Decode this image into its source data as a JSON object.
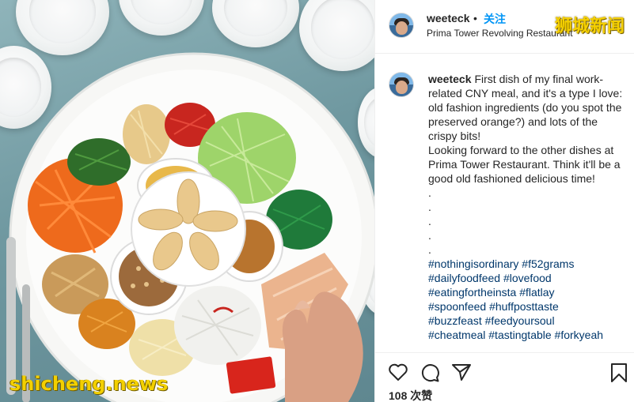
{
  "post": {
    "username": "weeteck",
    "follow_separator": "•",
    "follow_label": "关注",
    "location": "Prima Tower Revolving Restaurant"
  },
  "caption": {
    "username": "weeteck",
    "lines": [
      "First dish of my final work-related CNY meal, and it's a type I love: old fashion ingredients (do you spot the preserved orange?) and lots of the crispy bits!",
      "Looking forward to the other dishes at Prima Tower Restaurant. Think it'll be a good old fashioned delicious time!",
      ".",
      ".",
      ".",
      ".",
      "."
    ],
    "hashtags": [
      "#nothingisordinary #f52grams",
      "#dailyfoodfeed #lovefood",
      "#eatingfortheinsta #flatlay",
      "#spoonfeed #huffposttaste",
      "#buzzfeast #feedyoursoul",
      "#cheatmeal #tastingtable #forkyeah"
    ]
  },
  "actions": {
    "like_icon": "heart-icon",
    "comment_icon": "comment-icon",
    "share_icon": "paper-plane-icon",
    "save_icon": "bookmark-icon",
    "likes_text": "108 次赞"
  },
  "photo": {
    "subject": "Yu Sheng prosperity toss salad platter"
  },
  "watermarks": {
    "top_right": "狮城新闻",
    "bottom_left": "shicheng.news"
  },
  "colors": {
    "link_blue": "#0095f6",
    "hashtag": "#00376b",
    "watermark_yellow": "#f5d000"
  }
}
